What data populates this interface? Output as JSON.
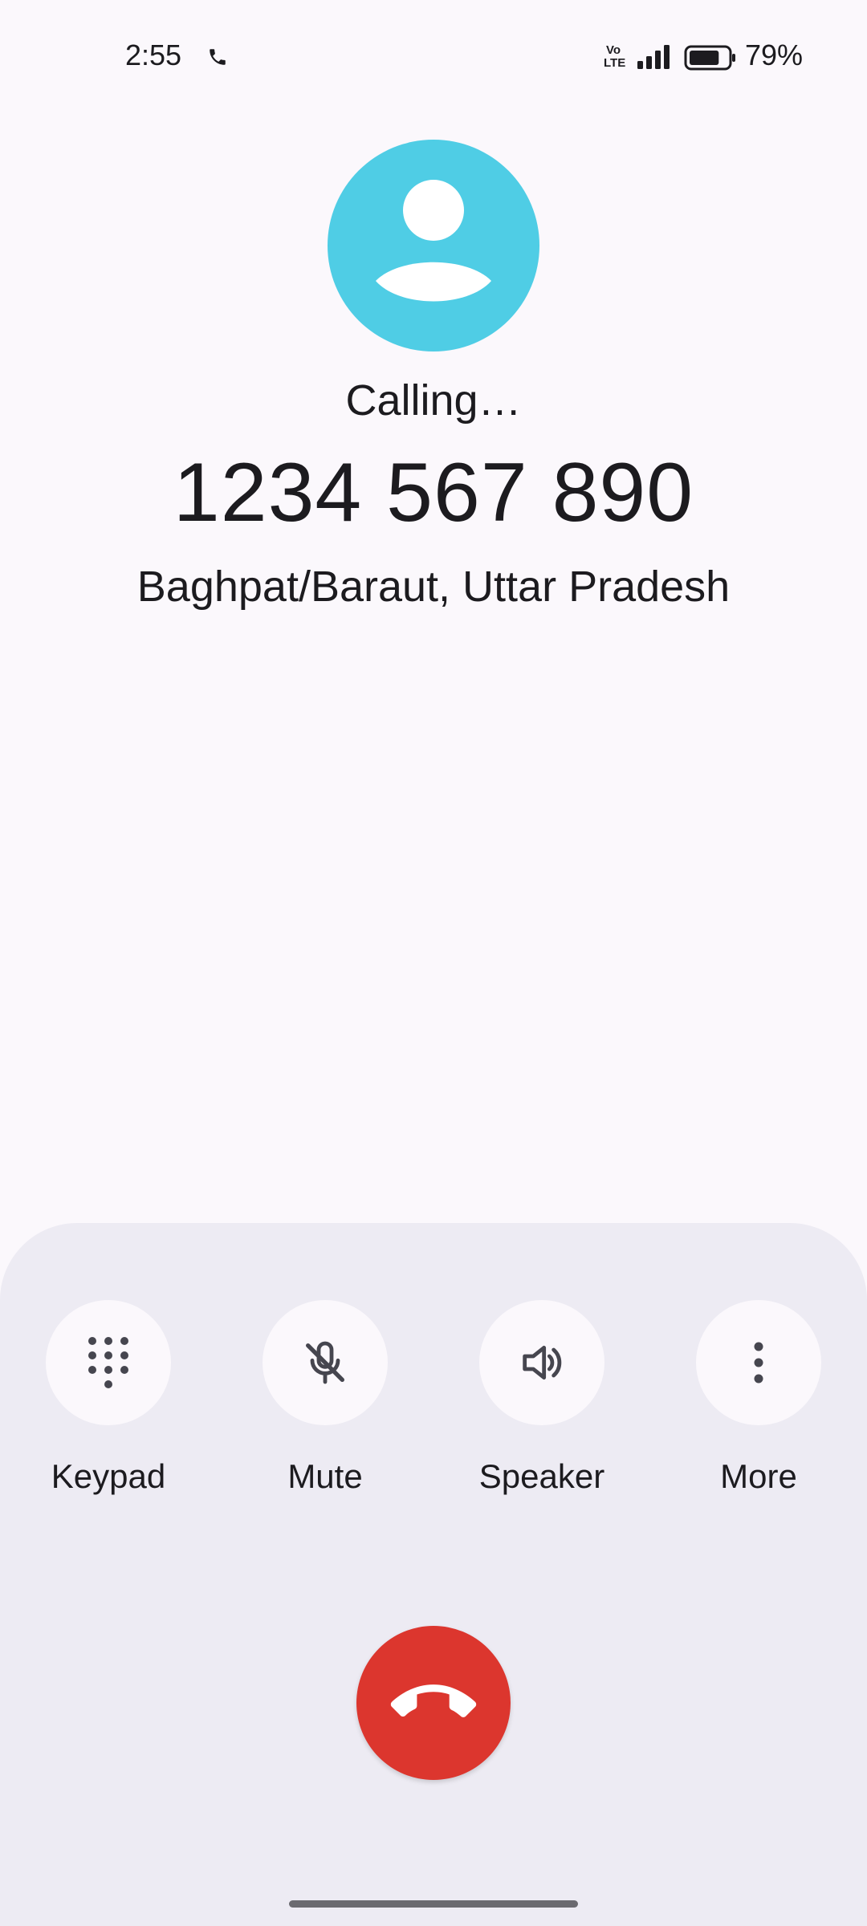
{
  "status_bar": {
    "time": "2:55",
    "network_badge_top": "Vo",
    "network_badge_bottom": "LTE",
    "battery_percent": "79%",
    "battery_level": 0.79,
    "icons": [
      "phone-call-icon",
      "signal-icon",
      "battery-icon"
    ]
  },
  "caller": {
    "status": "Calling…",
    "number": "1234 567 890",
    "location": "Baghpat/Baraut, Uttar Pradesh",
    "avatar_icon": "person-icon",
    "avatar_color": "#4fcde5"
  },
  "controls": [
    {
      "label": "Keypad",
      "icon": "dialpad-icon"
    },
    {
      "label": "Mute",
      "icon": "mic-off-icon"
    },
    {
      "label": "Speaker",
      "icon": "speaker-icon"
    },
    {
      "label": "More",
      "icon": "more-vert-icon"
    }
  ],
  "end_call": {
    "icon": "call-end-icon",
    "color": "#dc362e"
  }
}
